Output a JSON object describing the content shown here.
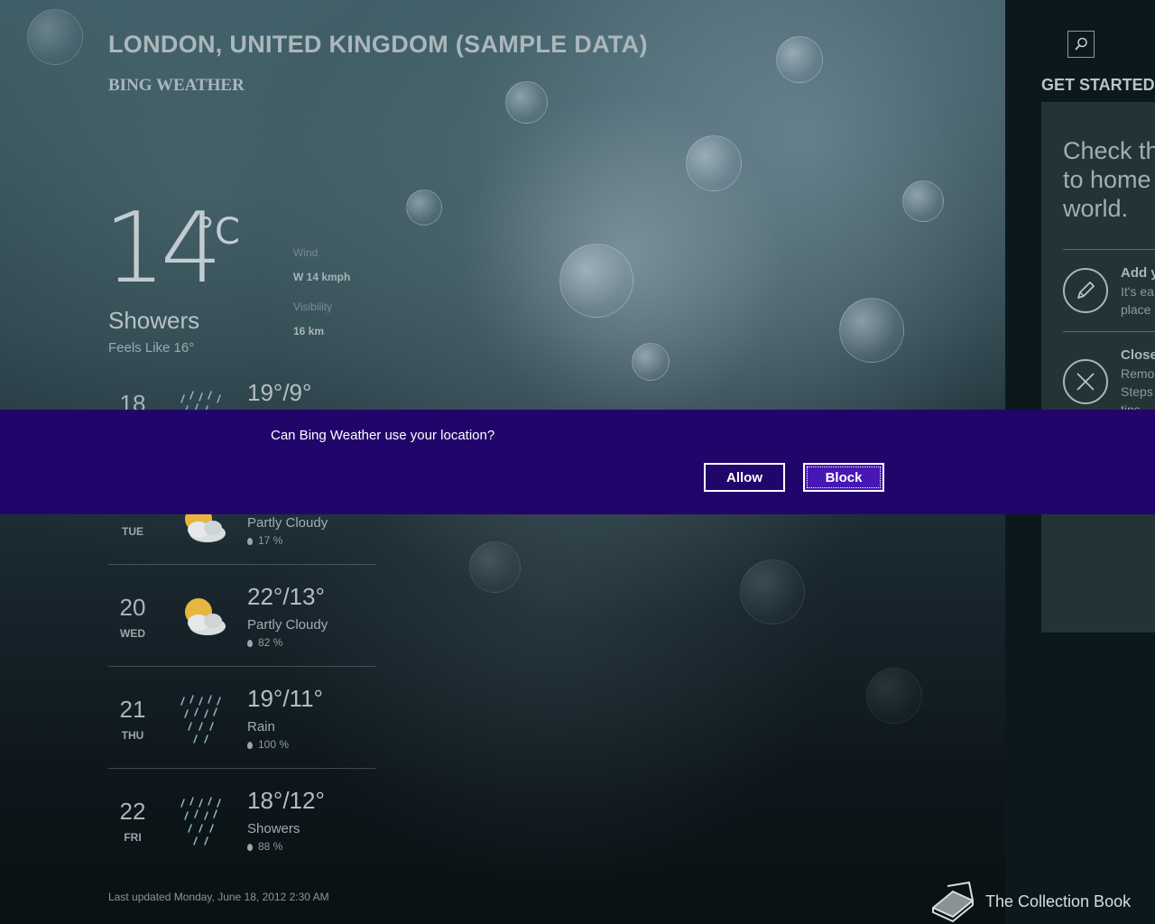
{
  "header": {
    "city": "LONDON, UNITED KINGDOM (SAMPLE DATA)",
    "app_name": "BING WEATHER"
  },
  "current": {
    "temperature": "14",
    "unit": "°C",
    "condition": "Showers",
    "feels_like": "Feels Like 16°",
    "wind_label": "Wind",
    "wind_value": "W 14 kmph",
    "visibility_label": "Visibility",
    "visibility_value": "16 km"
  },
  "forecast": [
    {
      "day": "18",
      "dow": "",
      "temps": "19°/9°",
      "condition": "",
      "precip": "",
      "icon": "rain-icon"
    },
    {
      "day": "",
      "dow": "TUE",
      "temps": "",
      "condition": "Partly Cloudy",
      "precip": "17 %",
      "icon": "partly-cloudy-icon"
    },
    {
      "day": "20",
      "dow": "WED",
      "temps": "22°/13°",
      "condition": "Partly Cloudy",
      "precip": "82 %",
      "icon": "partly-cloudy-icon"
    },
    {
      "day": "21",
      "dow": "THU",
      "temps": "19°/11°",
      "condition": "Rain",
      "precip": "100 %",
      "icon": "rain-icon"
    },
    {
      "day": "22",
      "dow": "FRI",
      "temps": "18°/12°",
      "condition": "Showers",
      "precip": "88 %",
      "icon": "rain-icon"
    }
  ],
  "last_updated": "Last updated Monday, June 18, 2012 2:30 AM",
  "side_panel": {
    "title": "GET STARTED",
    "card_heading": "Check th\nto home\nworld.",
    "items": [
      {
        "title": "Add y",
        "text": "It's ea\nplace",
        "icon": "pencil-icon"
      },
      {
        "title": "Close",
        "text": "Remo\nSteps\ntips",
        "icon": "close-icon"
      }
    ]
  },
  "dialog": {
    "message": "Can Bing Weather use your location?",
    "allow_label": "Allow",
    "block_label": "Block"
  },
  "watermark": {
    "text": "The Collection Book",
    "icon": "book-icon"
  }
}
